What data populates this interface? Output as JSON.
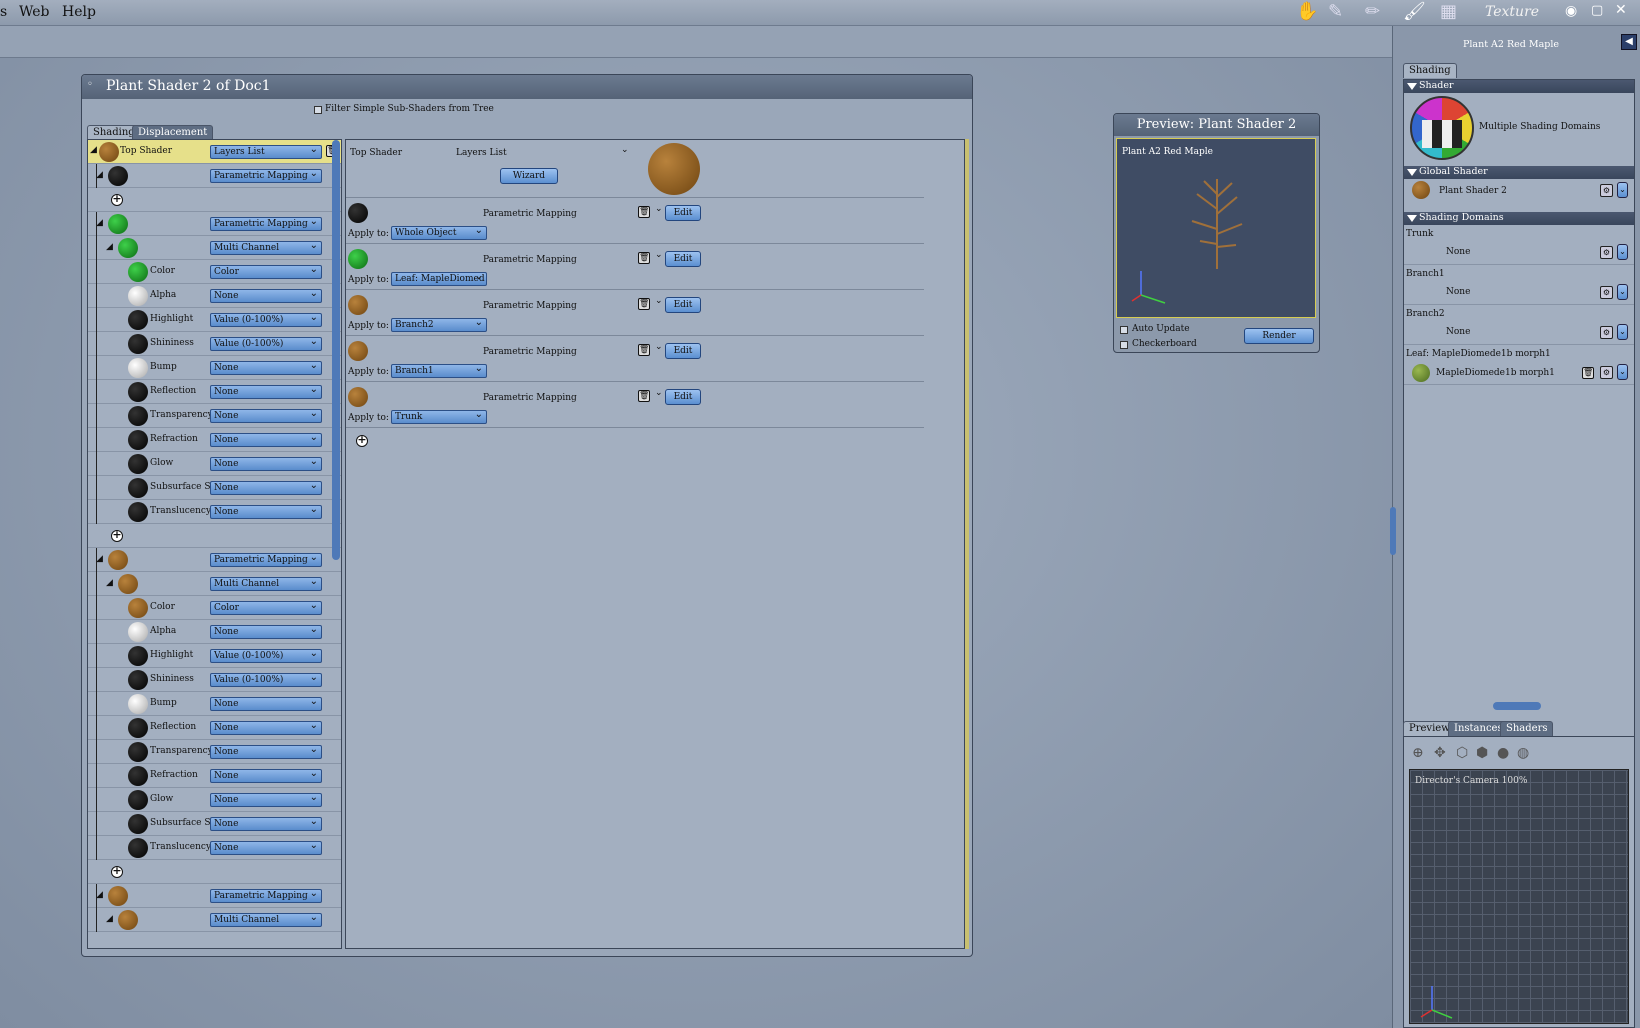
{
  "menu": {
    "item0": "s",
    "web": "Web",
    "help": "Help"
  },
  "room_label": "Texture",
  "window": {
    "title": "Plant Shader 2 of Doc1",
    "filter_label": "Filter Simple Sub-Shaders from Tree",
    "tabs": [
      "Shading",
      "Displacement"
    ]
  },
  "tree": {
    "top_shader": {
      "label": "Top Shader",
      "value": "Layers List"
    },
    "rows": [
      {
        "color": "black",
        "value": "Parametric Mapping"
      },
      {
        "color": "green",
        "value": "Parametric Mapping"
      },
      {
        "color": "green",
        "value": "Multi Channel"
      },
      {
        "color": "green",
        "label": "Color",
        "value": "Color"
      },
      {
        "color": "white",
        "label": "Alpha",
        "value": "None"
      },
      {
        "color": "black",
        "label": "Highlight",
        "value": "Value (0-100%)"
      },
      {
        "color": "black",
        "label": "Shininess",
        "value": "Value (0-100%)"
      },
      {
        "color": "white",
        "label": "Bump",
        "value": "None"
      },
      {
        "color": "black",
        "label": "Reflection",
        "value": "None"
      },
      {
        "color": "black",
        "label": "Transparency",
        "value": "None"
      },
      {
        "color": "black",
        "label": "Refraction",
        "value": "None"
      },
      {
        "color": "black",
        "label": "Glow",
        "value": "None"
      },
      {
        "color": "black",
        "label": "Subsurface Scat",
        "value": "None"
      },
      {
        "color": "black",
        "label": "Translucency",
        "value": "None"
      },
      {
        "color": "brown",
        "value": "Parametric Mapping"
      },
      {
        "color": "brown",
        "value": "Multi Channel"
      },
      {
        "color": "brown",
        "label": "Color",
        "value": "Color"
      },
      {
        "color": "white",
        "label": "Alpha",
        "value": "None"
      },
      {
        "color": "black",
        "label": "Highlight",
        "value": "Value (0-100%)"
      },
      {
        "color": "black",
        "label": "Shininess",
        "value": "Value (0-100%)"
      },
      {
        "color": "white",
        "label": "Bump",
        "value": "None"
      },
      {
        "color": "black",
        "label": "Reflection",
        "value": "None"
      },
      {
        "color": "black",
        "label": "Transparency",
        "value": "None"
      },
      {
        "color": "black",
        "label": "Refraction",
        "value": "None"
      },
      {
        "color": "black",
        "label": "Glow",
        "value": "None"
      },
      {
        "color": "black",
        "label": "Subsurface Scat",
        "value": "None"
      },
      {
        "color": "black",
        "label": "Translucency",
        "value": "None"
      },
      {
        "color": "brown",
        "value": "Parametric Mapping"
      },
      {
        "color": "brown",
        "value": "Multi Channel"
      }
    ]
  },
  "layers": {
    "top_label": "Top Shader",
    "type_label": "Layers List",
    "wizard": "Wizard",
    "apply_label": "Apply to:",
    "edit": "Edit",
    "items": [
      {
        "color": "black",
        "mapping": "Parametric Mapping",
        "apply": "Whole Object"
      },
      {
        "color": "green",
        "mapping": "Parametric Mapping",
        "apply": "Leaf: MapleDiomed"
      },
      {
        "color": "brown",
        "mapping": "Parametric Mapping",
        "apply": "Branch2"
      },
      {
        "color": "brown",
        "mapping": "Parametric Mapping",
        "apply": "Branch1"
      },
      {
        "color": "brown",
        "mapping": "Parametric Mapping",
        "apply": "Trunk"
      }
    ]
  },
  "preview": {
    "title": "Preview: Plant Shader 2",
    "object": "Plant A2 Red Maple",
    "auto_update": "Auto Update",
    "checkerboard": "Checkerboard",
    "render": "Render"
  },
  "right": {
    "title": "Plant A2 Red Maple",
    "tab": "Shading",
    "shader_hdr": "Shader",
    "shader_name": "Multiple Shading Domains",
    "global_hdr": "Global Shader",
    "global_name": "Plant Shader 2",
    "domains_hdr": "Shading Domains",
    "domains": [
      {
        "name": "Trunk",
        "value": "None"
      },
      {
        "name": "Branch1",
        "value": "None"
      },
      {
        "name": "Branch2",
        "value": "None"
      },
      {
        "name": "Leaf: MapleDiomede1b morph1",
        "value": "MapleDiomede1b morph1"
      }
    ],
    "bottom_tabs": [
      "Preview",
      "Instances",
      "Shaders"
    ],
    "camera": "Director's Camera 100%"
  }
}
